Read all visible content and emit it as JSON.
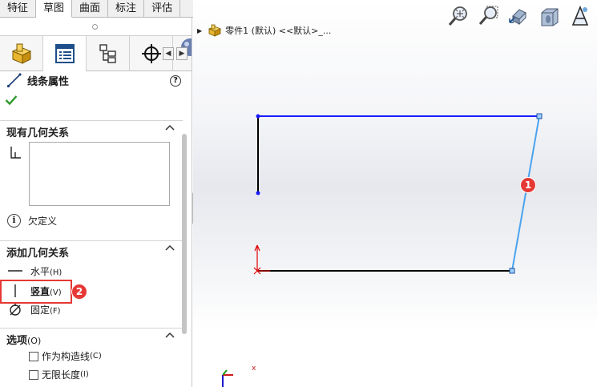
{
  "tabs": [
    {
      "label": "特征"
    },
    {
      "label": "草图"
    },
    {
      "label": "曲面"
    },
    {
      "label": "标注"
    },
    {
      "label": "评估"
    }
  ],
  "active_tab": "草图",
  "manager_tabs": [
    "feature-manager-icon",
    "property-manager-icon",
    "configuration-manager-icon",
    "dimxpert-manager-icon",
    "appearance-icon"
  ],
  "property_manager": {
    "title": "线条属性",
    "help": "?"
  },
  "existing_relations": {
    "heading": "现有几何关系",
    "status": "欠定义"
  },
  "add_relations": {
    "heading": "添加几何关系",
    "items": [
      {
        "label": "水平",
        "accel": "(H)"
      },
      {
        "label": "竖直",
        "accel": "(V)"
      },
      {
        "label": "固定",
        "accel": "(F)"
      }
    ]
  },
  "options": {
    "heading": "选项",
    "heading_accel": "(O)",
    "items": [
      {
        "label": "作为构造线",
        "accel": "(C)",
        "checked": false
      },
      {
        "label": "无限长度",
        "accel": "(I)",
        "checked": false
      }
    ]
  },
  "tree": {
    "part": "零件1 (默认) <<默认>_..."
  },
  "badges": {
    "one": "1",
    "two": "2"
  },
  "axis": {
    "x_label": "x"
  },
  "colors": {
    "accent_red": "#e53935",
    "sketch_blue": "#1a1aff",
    "selected_line": "#4aa3f0",
    "sketch_black": "#000000"
  }
}
